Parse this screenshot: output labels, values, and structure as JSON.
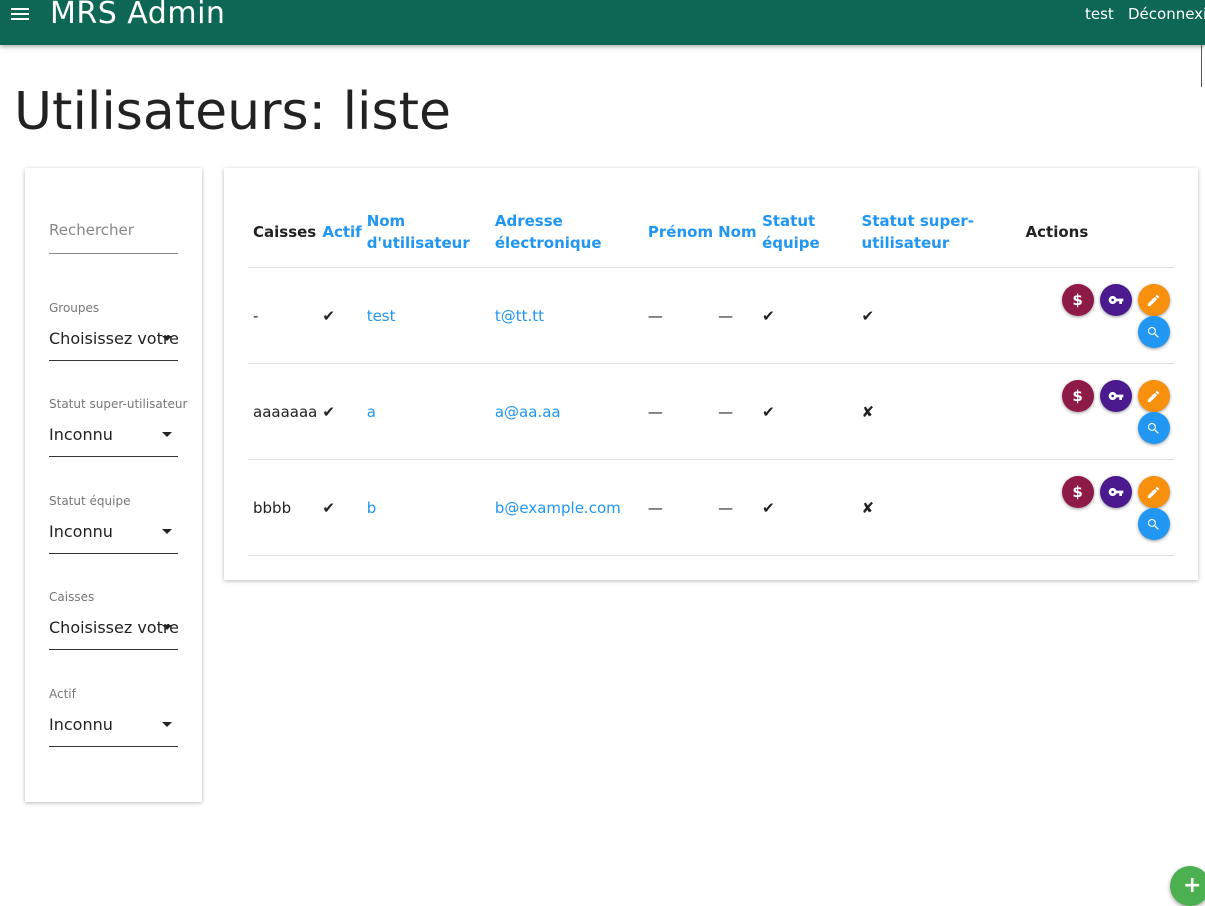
{
  "header": {
    "title": "MRS Admin",
    "user": "test",
    "logout": "Déconnexion"
  },
  "page": {
    "title": "Utilisateurs: liste"
  },
  "filters": {
    "search_placeholder": "Rechercher",
    "groups": {
      "label": "Groupes",
      "value": "Choisissez votre choix"
    },
    "superuser": {
      "label": "Statut super-utilisateur",
      "value": "Inconnu"
    },
    "staff": {
      "label": "Statut équipe",
      "value": "Inconnu"
    },
    "caisses": {
      "label": "Caisses",
      "value": "Choisissez votre choix"
    },
    "active": {
      "label": "Actif",
      "value": "Inconnu"
    }
  },
  "table": {
    "headers": {
      "caisses": "Caisses",
      "actif": "Actif",
      "username": "Nom d'utilisateur",
      "email": "Adresse électronique",
      "firstname": "Prénom",
      "lastname": "Nom",
      "staff": "Statut équipe",
      "superuser": "Statut super-utilisateur",
      "actions": "Actions"
    },
    "rows": [
      {
        "caisses": "-",
        "actif": "✔",
        "username": "test",
        "email": "t@tt.tt",
        "firstname": "—",
        "lastname": "—",
        "staff": "✔",
        "superuser": "✔"
      },
      {
        "caisses": "aaaaaaa",
        "actif": "✔",
        "username": "a",
        "email": "a@aa.aa",
        "firstname": "—",
        "lastname": "—",
        "staff": "✔",
        "superuser": "✘"
      },
      {
        "caisses": "bbbb",
        "actif": "✔",
        "username": "b",
        "email": "b@example.com",
        "firstname": "—",
        "lastname": "—",
        "staff": "✔",
        "superuser": "✘"
      }
    ]
  },
  "icons": {
    "menu": "menu-icon",
    "money": "dollar-icon",
    "key": "key-icon",
    "edit": "pencil-icon",
    "view": "search-icon",
    "add": "plus-icon",
    "money_glyph": "$",
    "add_glyph": "+"
  },
  "colors": {
    "appbar": "#0e6655",
    "link": "#2196f3",
    "money_button": "#8e1a48",
    "key_button": "#4a1a8e",
    "edit_button": "#f7900c",
    "view_button": "#2196f3",
    "add_button": "#4caf50"
  }
}
